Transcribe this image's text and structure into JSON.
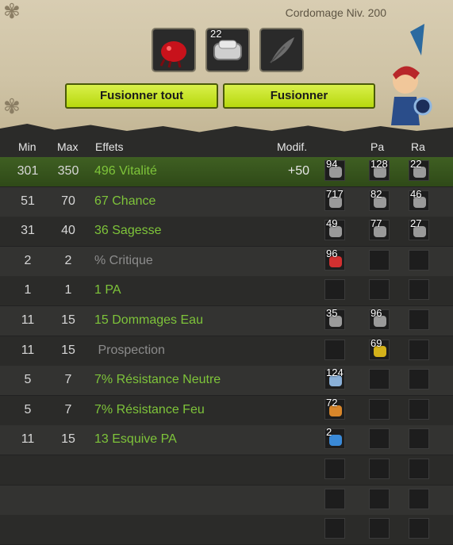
{
  "header": {
    "title": "Cordomage Niv. 200",
    "slots": [
      {
        "name": "red-item-slot",
        "count": "",
        "color": "#c8121b"
      },
      {
        "name": "rune-stack-slot",
        "count": "22",
        "color": "#c9c9c9"
      },
      {
        "name": "feather-slot",
        "count": "",
        "color": "#6d6d6d"
      }
    ],
    "buttons": {
      "merge_all": "Fusionner tout",
      "merge": "Fusionner"
    }
  },
  "table": {
    "columns": {
      "min": "Min",
      "max": "Max",
      "effects": "Effets",
      "modif": "Modif.",
      "pa": "Pa",
      "ra": "Ra"
    },
    "rows": [
      {
        "min": "301",
        "max": "350",
        "effect": "496 Vitalité",
        "mod": "+50",
        "style": "green",
        "highlight": true,
        "runes": [
          {
            "n": "94",
            "c": "#9a9a9a"
          },
          {
            "n": "128",
            "c": "#9a9a9a"
          },
          {
            "n": "22",
            "c": "#9a9a9a"
          }
        ]
      },
      {
        "min": "51",
        "max": "70",
        "effect": "67 Chance",
        "mod": "",
        "style": "green",
        "runes": [
          {
            "n": "717",
            "c": "#9a9a9a"
          },
          {
            "n": "82",
            "c": "#9a9a9a"
          },
          {
            "n": "46",
            "c": "#9a9a9a"
          }
        ]
      },
      {
        "min": "31",
        "max": "40",
        "effect": "36 Sagesse",
        "mod": "",
        "style": "green",
        "runes": [
          {
            "n": "49",
            "c": "#9a9a9a"
          },
          {
            "n": "77",
            "c": "#9a9a9a"
          },
          {
            "n": "27",
            "c": "#9a9a9a"
          }
        ]
      },
      {
        "min": "2",
        "max": "2",
        "effect": "% Critique",
        "mod": "",
        "style": "grey",
        "runes": [
          {
            "n": "96",
            "c": "#d23030"
          },
          {
            "n": "",
            "c": ""
          },
          {
            "n": "",
            "c": ""
          }
        ]
      },
      {
        "min": "1",
        "max": "1",
        "effect": "1 PA",
        "mod": "",
        "style": "green",
        "runes": [
          {
            "n": "",
            "c": ""
          },
          {
            "n": "",
            "c": ""
          },
          {
            "n": "",
            "c": ""
          }
        ]
      },
      {
        "min": "11",
        "max": "15",
        "effect": "15 Dommages Eau",
        "mod": "",
        "style": "green",
        "runes": [
          {
            "n": "35",
            "c": "#9a9a9a"
          },
          {
            "n": "96",
            "c": "#9a9a9a"
          },
          {
            "n": "",
            "c": ""
          }
        ]
      },
      {
        "min": "11",
        "max": "15",
        "effect": " Prospection",
        "mod": "",
        "style": "grey",
        "runes": [
          {
            "n": "",
            "c": ""
          },
          {
            "n": "69",
            "c": "#d4b21a"
          },
          {
            "n": "",
            "c": ""
          }
        ]
      },
      {
        "min": "5",
        "max": "7",
        "effect": "7% Résistance Neutre",
        "mod": "",
        "style": "green",
        "runes": [
          {
            "n": "124",
            "c": "#8ab0d8"
          },
          {
            "n": "",
            "c": ""
          },
          {
            "n": "",
            "c": ""
          }
        ]
      },
      {
        "min": "5",
        "max": "7",
        "effect": "7% Résistance Feu",
        "mod": "",
        "style": "green",
        "runes": [
          {
            "n": "72",
            "c": "#d8862a"
          },
          {
            "n": "",
            "c": ""
          },
          {
            "n": "",
            "c": ""
          }
        ]
      },
      {
        "min": "11",
        "max": "15",
        "effect": "13 Esquive PA",
        "mod": "",
        "style": "green",
        "runes": [
          {
            "n": "2",
            "c": "#3a8ad8"
          },
          {
            "n": "",
            "c": ""
          },
          {
            "n": "",
            "c": ""
          }
        ]
      },
      {
        "min": "",
        "max": "",
        "effect": "",
        "mod": "",
        "style": "green",
        "runes": [
          {
            "n": "",
            "c": ""
          },
          {
            "n": "",
            "c": ""
          },
          {
            "n": "",
            "c": ""
          }
        ]
      },
      {
        "min": "",
        "max": "",
        "effect": "",
        "mod": "",
        "style": "green",
        "runes": [
          {
            "n": "",
            "c": ""
          },
          {
            "n": "",
            "c": ""
          },
          {
            "n": "",
            "c": ""
          }
        ]
      },
      {
        "min": "",
        "max": "",
        "effect": "",
        "mod": "",
        "style": "green",
        "runes": [
          {
            "n": "",
            "c": ""
          },
          {
            "n": "",
            "c": ""
          },
          {
            "n": "",
            "c": ""
          }
        ]
      }
    ]
  }
}
